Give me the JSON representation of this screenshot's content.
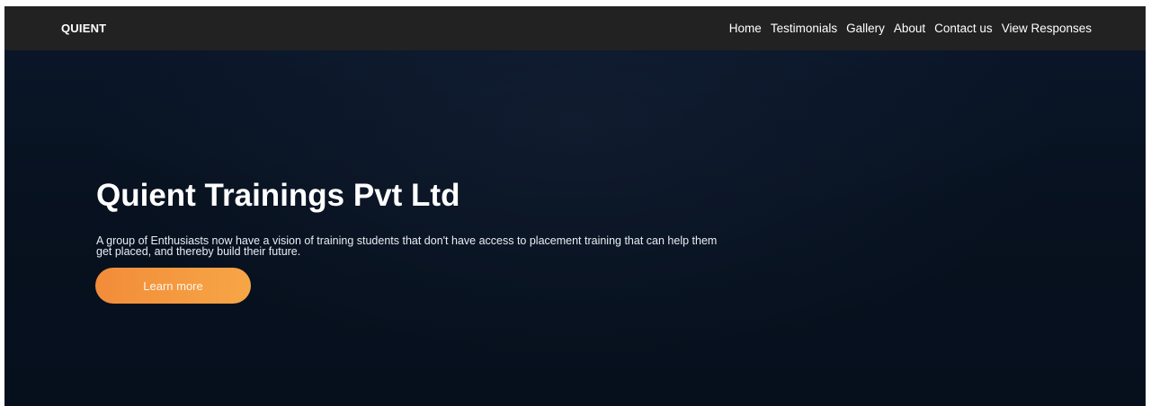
{
  "navbar": {
    "brand": "QUIENT",
    "links": [
      {
        "label": "Home"
      },
      {
        "label": "Testimonials"
      },
      {
        "label": "Gallery"
      },
      {
        "label": "About"
      },
      {
        "label": "Contact us"
      },
      {
        "label": "View Responses"
      }
    ]
  },
  "hero": {
    "title": "Quient Trainings Pvt Ltd",
    "description": "A group of Enthusiasts now have a vision of training students that don't have access to placement training that can help them get placed, and thereby build their future.",
    "cta_label": "Learn more"
  },
  "colors": {
    "navbar_bg": "#222222",
    "hero_bg": "#06101f",
    "cta_start": "#f28c3a",
    "cta_end": "#f6a646"
  }
}
